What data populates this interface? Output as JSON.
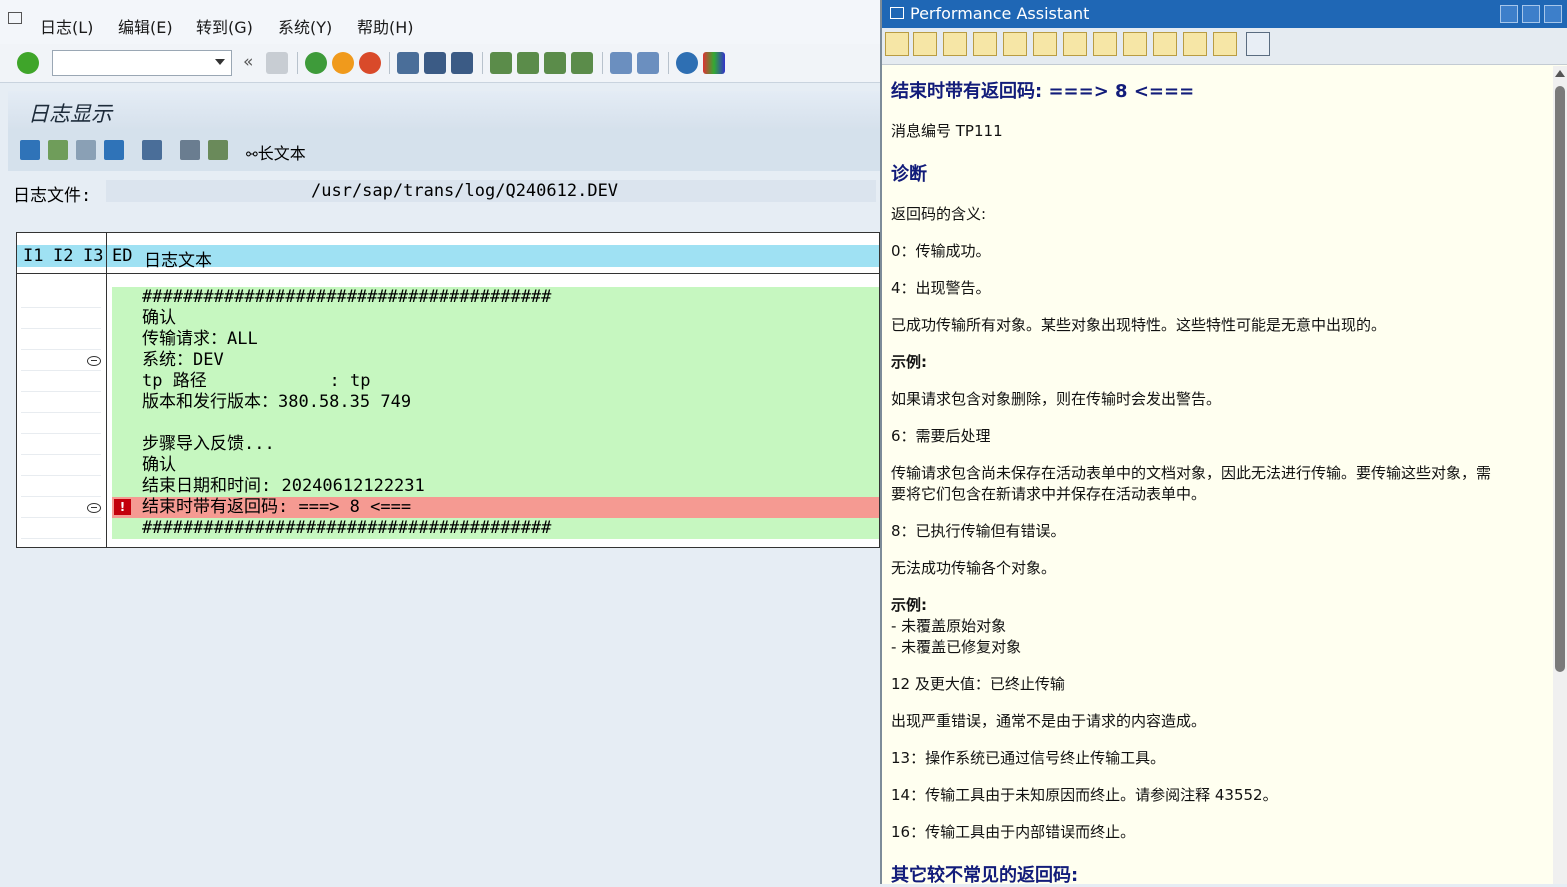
{
  "menu": [
    "日志(L)",
    "编辑(E)",
    "转到(G)",
    "系统(Y)",
    "帮助(H)"
  ],
  "toolbar": {
    "back_label": "«"
  },
  "screen": {
    "title": "日志显示",
    "longtext_label": "长文本",
    "file_label": "日志文件:",
    "file_value": "/usr/sap/trans/log/Q240612.DEV"
  },
  "table": {
    "headers": [
      "I1",
      "I2",
      "I3",
      "ED",
      "日志文本"
    ],
    "rows": [
      "########################################",
      "确认",
      "传输请求：ALL",
      "系统：DEV",
      "tp 路径            : tp",
      "版本和发行版本：380.58.35 749",
      "",
      "步骤导入反馈...",
      "确认",
      "结束日期和时间: 20240612122231",
      "结束时带有返回码: ===> 8 <===",
      "########################################"
    ],
    "error_row_index": 10,
    "error_icon": "!"
  },
  "assistant": {
    "title": "Performance Assistant",
    "heading": "结束时带有返回码: ===> 8 <===",
    "msg_no": "消息编号 TP111",
    "diag": "诊断",
    "meaning": "返回码的含义:",
    "rc0": "0：传输成功。",
    "rc4": "4：出现警告。",
    "rc4_desc": "已成功传输所有对象。某些对象出现特性。这些特性可能是无意中出现的。",
    "example": "示例:",
    "ex1": "如果请求包含对象删除，则在传输时会发出警告。",
    "rc6": "6：需要后处理",
    "rc6_desc1": "传输请求包含尚未保存在活动表单中的文档对象，因此无法进行传输。要传输这些对象，需",
    "rc6_desc2": "要将它们包含在新请求中并保存在活动表单中。",
    "rc8": "8：已执行传输但有错误。",
    "rc8_desc": "无法成功传输各个对象。",
    "example2": "示例:",
    "ex2a": "- 未覆盖原始对象",
    "ex2b": "- 未覆盖已修复对象",
    "rc12": "12 及更大值：已终止传输",
    "rc12_desc": "出现严重错误，通常不是由于请求的内容造成。",
    "rc13": "13：操作系统已通过信号终止传输工具。",
    "rc14": "14：传输工具由于未知原因而终止。请参阅注释 43552。",
    "rc16": "16：传输工具由于内部错误而终止。",
    "other": "其它较不常见的返回码:"
  },
  "colors": {
    "row_ok": "#c6f7c0",
    "row_error": "#f59a92",
    "header": "#9fe1f3",
    "assistant_heading": "#121c7a",
    "assistant_titlebar": "#1f67b5"
  }
}
